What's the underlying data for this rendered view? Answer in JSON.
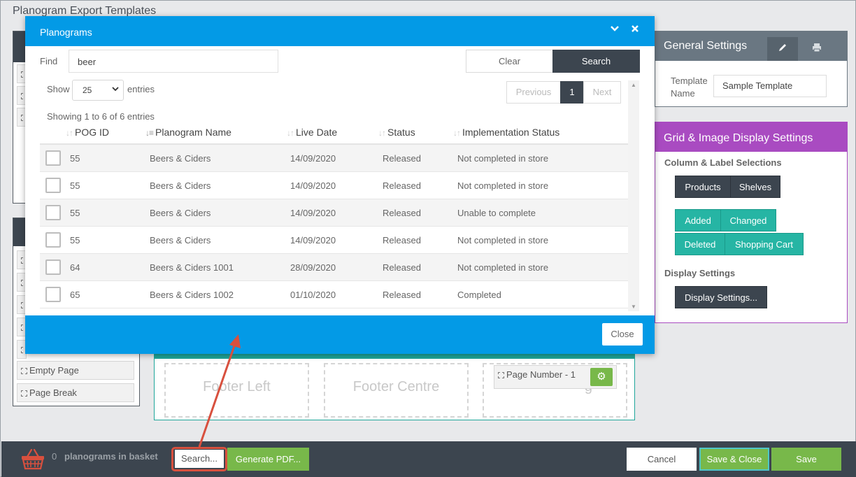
{
  "page": {
    "title": "Planogram Export Templates"
  },
  "left_items": {
    "empty_page": "Empty Page",
    "page_break": "Page Break"
  },
  "footer_preview": {
    "left": "Footer Left",
    "centre": "Footer Centre",
    "right_partial": "g",
    "page_number": "Page Number - 1"
  },
  "general_settings": {
    "title": "General Settings",
    "template_name_label": "Template Name",
    "template_name_value": "Sample Template",
    "icons": [
      "pencil-icon",
      "printer-icon"
    ]
  },
  "grid_image": {
    "title": "Grid & Image Display Settings",
    "column_label_section": "Column & Label Selections",
    "products": "Products",
    "shelves": "Shelves",
    "added": "Added",
    "changed": "Changed",
    "deleted": "Deleted",
    "shopping_cart": "Shopping Cart",
    "display_section": "Display Settings",
    "display_settings_button": "Display Settings..."
  },
  "bottom_bar": {
    "basket_count": "0",
    "basket_label": "planograms in basket",
    "search": "Search...",
    "generate_pdf": "Generate PDF...",
    "cancel": "Cancel",
    "save_close": "Save & Close",
    "save": "Save"
  },
  "modal": {
    "title": "Planograms",
    "find_label": "Find",
    "find_value": "beer",
    "clear": "Clear",
    "search": "Search",
    "show_label": "Show",
    "page_length": "25",
    "entries_label": "entries",
    "previous": "Previous",
    "current_page": "1",
    "next": "Next",
    "info": "Showing 1 to 6 of 6 entries",
    "columns": [
      "POG ID",
      "Planogram Name",
      "Live Date",
      "Status",
      "Implementation Status"
    ],
    "rows": [
      {
        "id": "55",
        "name": "Beers & Ciders",
        "date": "14/09/2020",
        "status": "Released",
        "impl": "Not completed in store"
      },
      {
        "id": "55",
        "name": "Beers & Ciders",
        "date": "14/09/2020",
        "status": "Released",
        "impl": "Not completed in store"
      },
      {
        "id": "55",
        "name": "Beers & Ciders",
        "date": "14/09/2020",
        "status": "Released",
        "impl": "Unable to complete"
      },
      {
        "id": "55",
        "name": "Beers & Ciders",
        "date": "14/09/2020",
        "status": "Released",
        "impl": "Not completed in store"
      },
      {
        "id": "64",
        "name": "Beers & Ciders 1001",
        "date": "28/09/2020",
        "status": "Released",
        "impl": "Not completed in store"
      },
      {
        "id": "65",
        "name": "Beers & Ciders 1002",
        "date": "01/10/2020",
        "status": "Released",
        "impl": "Completed"
      }
    ],
    "close": "Close"
  },
  "colors": {
    "modal_blue": "#039ae6",
    "dark": "#3c454f",
    "green": "#78b84a",
    "teal": "#26b5a4",
    "purple": "#a94bc1",
    "annotation_red": "#d8503e"
  }
}
